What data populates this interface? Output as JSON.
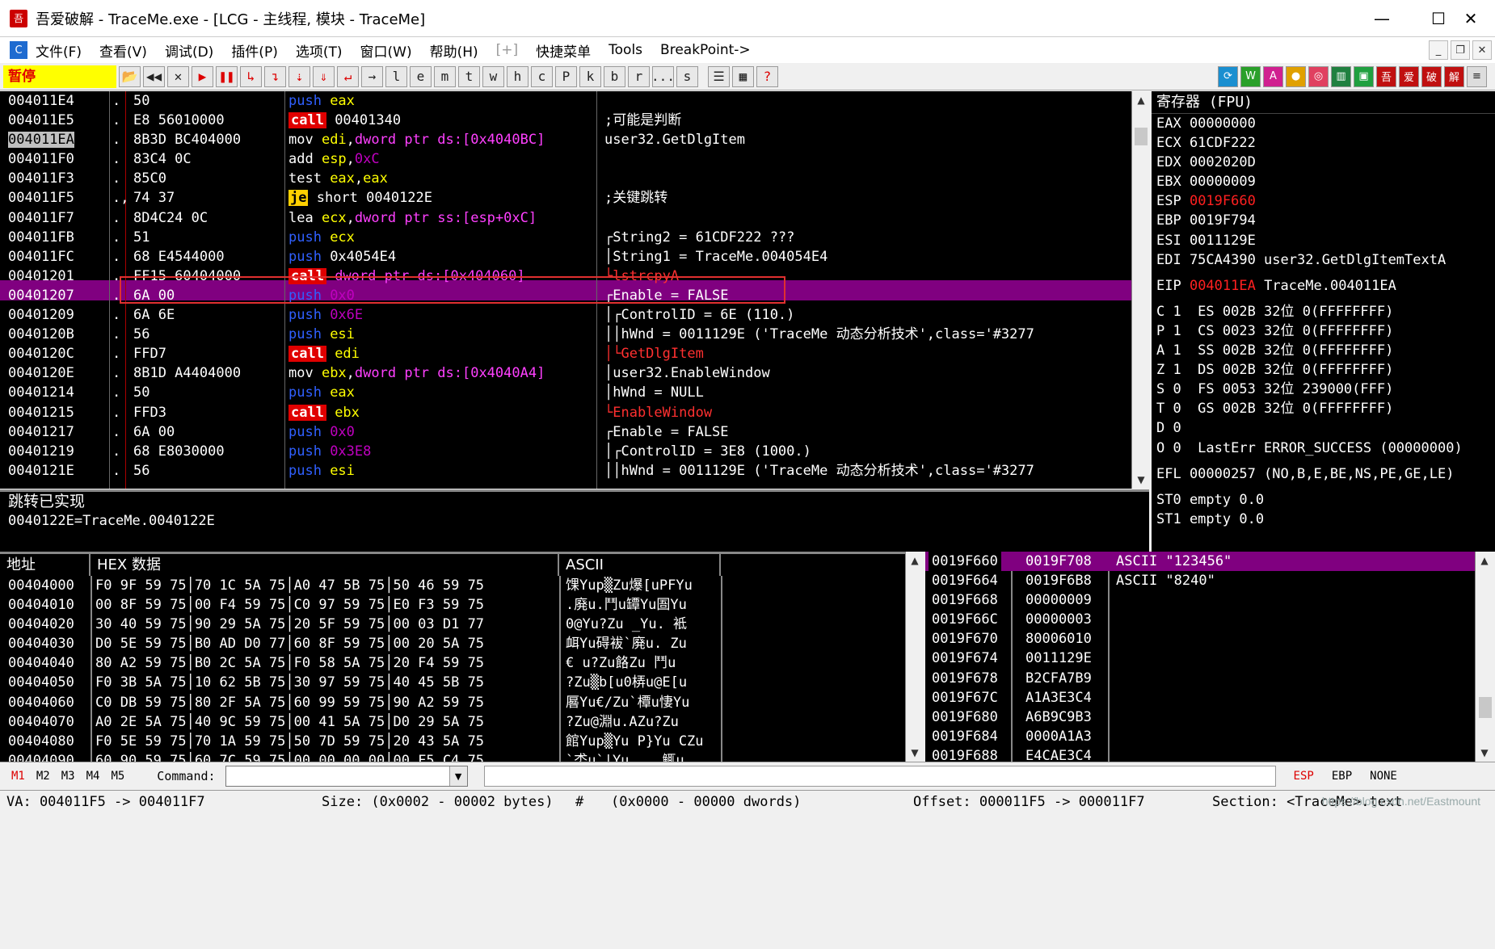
{
  "window": {
    "title": "吾爱破解 - TraceMe.exe - [LCG - 主线程, 模块 - TraceMe]",
    "app_icon": "吾",
    "min": "—",
    "max": "☐",
    "close": "✕"
  },
  "menu": {
    "items": [
      "文件(F)",
      "查看(V)",
      "调试(D)",
      "插件(P)",
      "选项(T)",
      "窗口(W)",
      "帮助(H)",
      "[+]",
      "快捷菜单",
      "Tools",
      "BreakPoint->"
    ]
  },
  "toolbar": {
    "status": "暂停",
    "letters": [
      "l",
      "e",
      "m",
      "t",
      "w",
      "h",
      "c",
      "P",
      "k",
      "b",
      "r",
      "...",
      "s"
    ]
  },
  "cpu_rows": [
    {
      "addr": "004011E4",
      "dot": ".",
      "hex": "50",
      "asm": [
        [
          "push",
          "push"
        ],
        [
          "reg",
          " eax"
        ]
      ],
      "cmt": ""
    },
    {
      "addr": "004011E5",
      "dot": ".",
      "hex": "E8 56010000",
      "asm": [
        [
          "call",
          "call"
        ],
        [
          "op",
          " 00401340"
        ]
      ],
      "cmt": ";可能是判断"
    },
    {
      "addr": "004011EA",
      "dot": ".",
      "hex": "8B3D BC404000",
      "asm": [
        [
          "op",
          "mov "
        ],
        [
          "reg",
          "edi"
        ],
        [
          "op",
          ","
        ],
        [
          "ptr",
          "dword ptr ds:[0x4040BC]"
        ]
      ],
      "cmt": "user32.GetDlgItem",
      "sel": true
    },
    {
      "addr": "004011F0",
      "dot": ".",
      "hex": "83C4 0C",
      "asm": [
        [
          "op",
          "add "
        ],
        [
          "reg",
          "esp"
        ],
        [
          "op",
          ","
        ],
        [
          "imm",
          "0xC"
        ]
      ],
      "cmt": ""
    },
    {
      "addr": "004011F3",
      "dot": ".",
      "hex": "85C0",
      "asm": [
        [
          "op",
          "test "
        ],
        [
          "reg",
          "eax"
        ],
        [
          "op",
          ","
        ],
        [
          "reg",
          "eax"
        ]
      ],
      "cmt": ""
    },
    {
      "addr": "004011F5",
      "dot": ".,",
      "hex": "74 37",
      "asm": [
        [
          "je",
          "je"
        ],
        [
          "op",
          " short 0040122E"
        ]
      ],
      "cmt": ";关键跳转",
      "hl": true
    },
    {
      "addr": "004011F7",
      "dot": ".",
      "hex": "8D4C24 0C",
      "asm": [
        [
          "op",
          "lea "
        ],
        [
          "reg",
          "ecx"
        ],
        [
          "op",
          ","
        ],
        [
          "ptr",
          "dword ptr ss:[esp+0xC]"
        ]
      ],
      "cmt": ""
    },
    {
      "addr": "004011FB",
      "dot": ".",
      "hex": "51",
      "asm": [
        [
          "push",
          "push"
        ],
        [
          "reg",
          " ecx"
        ]
      ],
      "cmt": "┌String2 = 61CDF222 ???"
    },
    {
      "addr": "004011FC",
      "dot": ".",
      "hex": "68 E4544000",
      "asm": [
        [
          "push",
          "push"
        ],
        [
          "op",
          " 0x4054E4"
        ]
      ],
      "cmt": "│String1 = TraceMe.004054E4"
    },
    {
      "addr": "00401201",
      "dot": ".",
      "hex": "FF15 60404000",
      "asm": [
        [
          "call",
          "call"
        ],
        [
          "ptr",
          " dword ptr ds:[0x404060]"
        ]
      ],
      "cmt": "└lstrcpyA",
      "cmtred": true
    },
    {
      "addr": "00401207",
      "dot": ".",
      "hex": "6A 00",
      "asm": [
        [
          "push",
          "push"
        ],
        [
          "imm",
          " 0x0"
        ]
      ],
      "cmt": "┌Enable = FALSE"
    },
    {
      "addr": "00401209",
      "dot": ".",
      "hex": "6A 6E",
      "asm": [
        [
          "push",
          "push"
        ],
        [
          "imm",
          " 0x6E"
        ]
      ],
      "cmt": "│┌ControlID = 6E (110.)"
    },
    {
      "addr": "0040120B",
      "dot": ".",
      "hex": "56",
      "asm": [
        [
          "push",
          "push"
        ],
        [
          "reg",
          " esi"
        ]
      ],
      "cmt": "││hWnd = 0011129E ('TraceMe 动态分析技术',class='#3277"
    },
    {
      "addr": "0040120C",
      "dot": ".",
      "hex": "FFD7",
      "asm": [
        [
          "call",
          "call"
        ],
        [
          "reg",
          " edi"
        ]
      ],
      "cmt": "│└GetDlgItem",
      "cmtred": true
    },
    {
      "addr": "0040120E",
      "dot": ".",
      "hex": "8B1D A4404000",
      "asm": [
        [
          "op",
          "mov "
        ],
        [
          "reg",
          "ebx"
        ],
        [
          "op",
          ","
        ],
        [
          "ptr",
          "dword ptr ds:[0x4040A4]"
        ]
      ],
      "cmt": "│user32.EnableWindow"
    },
    {
      "addr": "00401214",
      "dot": ".",
      "hex": "50",
      "asm": [
        [
          "push",
          "push"
        ],
        [
          "reg",
          " eax"
        ]
      ],
      "cmt": "│hWnd = NULL"
    },
    {
      "addr": "00401215",
      "dot": ".",
      "hex": "FFD3",
      "asm": [
        [
          "call",
          "call"
        ],
        [
          "reg",
          " ebx"
        ]
      ],
      "cmt": "└EnableWindow",
      "cmtred": true
    },
    {
      "addr": "00401217",
      "dot": ".",
      "hex": "6A 00",
      "asm": [
        [
          "push",
          "push"
        ],
        [
          "imm",
          " 0x0"
        ]
      ],
      "cmt": "┌Enable = FALSE"
    },
    {
      "addr": "00401219",
      "dot": ".",
      "hex": "68 E8030000",
      "asm": [
        [
          "push",
          "push"
        ],
        [
          "imm",
          " 0x3E8"
        ]
      ],
      "cmt": "│┌ControlID = 3E8 (1000.)"
    },
    {
      "addr": "0040121E",
      "dot": ".",
      "hex": "56",
      "asm": [
        [
          "push",
          "push"
        ],
        [
          "reg",
          " esi"
        ]
      ],
      "cmt": "││hWnd = 0011129E ('TraceMe 动态分析技术',class='#3277"
    }
  ],
  "regs": {
    "header": "寄存器 (FPU)",
    "rows": [
      {
        "t": "EAX 00000000"
      },
      {
        "t": "ECX 61CDF222"
      },
      {
        "t": "EDX 0002020D"
      },
      {
        "t": "EBX 00000009"
      },
      {
        "n": "ESP ",
        "v": "0019F660",
        "red": true
      },
      {
        "t": "EBP 0019F794"
      },
      {
        "t": "ESI 0011129E"
      },
      {
        "t": "EDI 75CA4390 user32.GetDlgItemTextA"
      },
      {
        "t": ""
      },
      {
        "n": "EIP ",
        "v": "004011EA",
        "red": true,
        "rest": " TraceMe.004011EA"
      },
      {
        "t": ""
      },
      {
        "t": "C 1  ES 002B 32位 0(FFFFFFFF)"
      },
      {
        "t": "P 1  CS 0023 32位 0(FFFFFFFF)"
      },
      {
        "t": "A 1  SS 002B 32位 0(FFFFFFFF)"
      },
      {
        "t": "Z 1  DS 002B 32位 0(FFFFFFFF)"
      },
      {
        "t": "S 0  FS 0053 32位 239000(FFF)"
      },
      {
        "t": "T 0  GS 002B 32位 0(FFFFFFFF)"
      },
      {
        "t": "D 0"
      },
      {
        "t": "O 0  LastErr ERROR_SUCCESS (00000000)"
      },
      {
        "t": ""
      },
      {
        "t": "EFL 00000257 (NO,B,E,BE,NS,PE,GE,LE)"
      },
      {
        "t": ""
      },
      {
        "t": "ST0 empty 0.0"
      },
      {
        "t": "ST1 empty 0.0"
      }
    ]
  },
  "info": {
    "line1": "跳转已实现",
    "line2": "0040122E=TraceMe.0040122E"
  },
  "dump": {
    "hdr_addr": "地址",
    "hdr_hex": "HEX 数据",
    "hdr_ascii": "ASCII",
    "rows": [
      {
        "a": "00404000",
        "h": "F0 9F 59 75│70 1C 5A 75│A0 47 5B 75│50 46 59 75",
        "s": "馃Yup▒Zu爆[uPFYu"
      },
      {
        "a": "00404010",
        "h": "00 8F 59 75│00 F4 59 75│C0 97 59 75│E0 F3 59 75",
        "s": ".廃u.鬥u罈Yu圄Yu"
      },
      {
        "a": "00404020",
        "h": "30 40 59 75│90 29 5A 75│20 5F 59 75│00 03 D1 77",
        "s": "0@Yu?Zu _Yu. 袛"
      },
      {
        "a": "00404030",
        "h": "D0 5E 59 75│B0 AD D0 77│60 8F 59 75│00 20 5A 75",
        "s": "衈Yu碍袚`廃u. Zu"
      },
      {
        "a": "00404040",
        "h": "80 A2 59 75│B0 2C 5A 75│F0 58 5A 75│20 F4 59 75",
        "s": "€ u?Zu餎Zu 鬥u"
      },
      {
        "a": "00404050",
        "h": "F0 3B 5A 75│10 62 5B 75│30 97 59 75│40 45 5B 75",
        "s": "?Zu▒b[u0梇u@E[u"
      },
      {
        "a": "00404060",
        "h": "C0 DB 59 75│80 2F 5A 75│60 99 59 75│90 A2 59 75",
        "s": "厬Yu€/Zu`橝u悽Yu"
      },
      {
        "a": "00404070",
        "h": "A0 2E 5A 75│40 9C 59 75│00 41 5A 75│D0 29 5A 75",
        "s": "?Zu@淵u.AZu?Zu"
      },
      {
        "a": "00404080",
        "h": "F0 5E 59 75│70 1A 59 75│50 7D 59 75│20 43 5A 75",
        "s": "館Yup▒Yu P}Yu CZu"
      },
      {
        "a": "00404090",
        "h": "60 90 59 75│60 7C 59 75│00 00 00 00│00 F5 C4 75",
        "s": "`怸u`|Yu....鮿u"
      }
    ]
  },
  "stack": {
    "rows": [
      {
        "a": "0019F660",
        "v": "0019F708",
        "c": "ASCII \"123456\"",
        "sel": true
      },
      {
        "a": "0019F664",
        "v": "0019F6B8",
        "c": "ASCII \"8240\""
      },
      {
        "a": "0019F668",
        "v": "00000009",
        "c": ""
      },
      {
        "a": "0019F66C",
        "v": "00000003",
        "c": ""
      },
      {
        "a": "0019F670",
        "v": "80006010",
        "c": ""
      },
      {
        "a": "0019F674",
        "v": "0011129E",
        "c": ""
      },
      {
        "a": "0019F678",
        "v": "B2CFA7B9",
        "c": ""
      },
      {
        "a": "0019F67C",
        "v": "A1A3E3C4",
        "c": ""
      },
      {
        "a": "0019F680",
        "v": "A6B9C9B3",
        "c": ""
      },
      {
        "a": "0019F684",
        "v": "0000A1A3",
        "c": ""
      },
      {
        "a": "0019F688",
        "v": "E4CAE3C4",
        "c": ""
      }
    ]
  },
  "cmdbar": {
    "m1": "M1",
    "m2": "M2",
    "m3": "M3",
    "m4": "M4",
    "m5": "M5",
    "label": "Command:",
    "esp": "ESP",
    "ebp": "EBP",
    "none": "NONE"
  },
  "statusbar": {
    "va": "VA: 004011F5 -> 004011F7",
    "size": "Size: (0x0002 - 00002 bytes)",
    "hash": "#",
    "dwords": "(0x0000 - 00000 dwords)",
    "offset": "Offset: 000011F5 -> 000011F7",
    "section": "Section: <TraceMe>.text"
  },
  "watermark": "https://blog.csdn.net/Eastmount"
}
